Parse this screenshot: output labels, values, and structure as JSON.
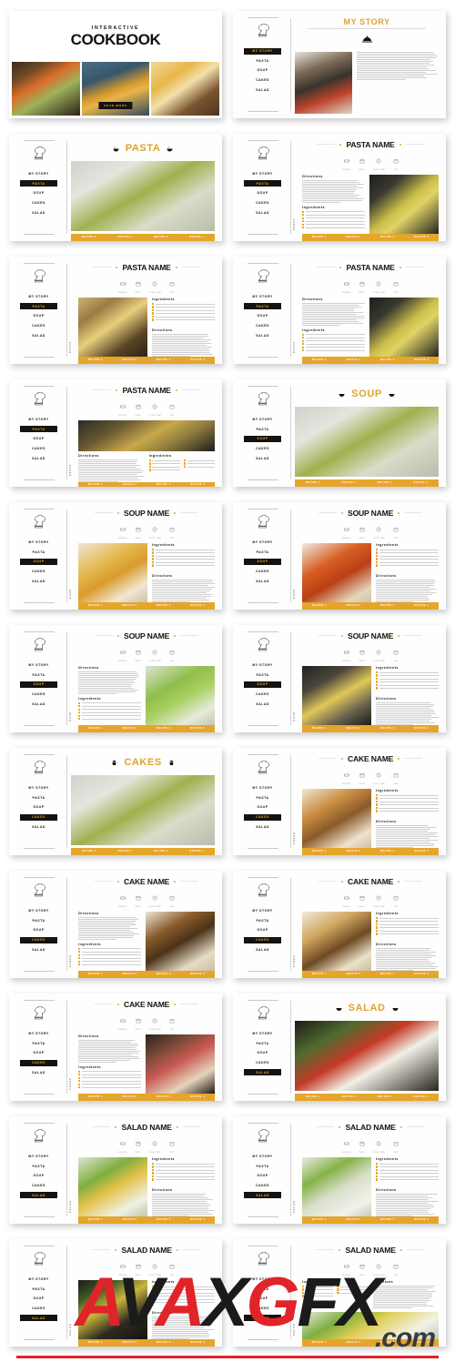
{
  "meta": {
    "accent_yellow": "#E6A52A",
    "accent_title_yellow": "#E2A12C",
    "dark": "#15120F",
    "watermark_red": "#E0242A"
  },
  "nav": {
    "items": [
      "MY STORY",
      "PASTA",
      "SOUP",
      "CAKES",
      "SALAD"
    ],
    "logo_icon": "chef-hat-icon"
  },
  "recipe_bar": {
    "buttons": [
      "RECIPE 1",
      "RECIPE 2",
      "RECIPE 3",
      "RECIPE 4"
    ]
  },
  "meta_icons": [
    {
      "icon": "plate-cutlery-icon",
      "label": "SERVES"
    },
    {
      "icon": "calendar-icon",
      "label": "DATE"
    },
    {
      "icon": "clock-icon",
      "label": "COOK TIME"
    },
    {
      "icon": "oven-icon",
      "label": "FAT"
    }
  ],
  "blocks": {
    "directions": "Directions",
    "ingredients": "Ingredients"
  },
  "cover": {
    "subtitle": "INTERACTIVE",
    "title": "COOKBOOK",
    "button": "READ MORE",
    "images": [
      "salad-photo",
      "pasta-pan-photo",
      "orange-cake-photo"
    ]
  },
  "slides": [
    {
      "id": "cover",
      "type": "cover"
    },
    {
      "id": "my-story",
      "type": "story",
      "title": "MY STORY",
      "active": "MY STORY",
      "icon": "cloche-icon",
      "photo": "p-story"
    },
    {
      "id": "pasta-section",
      "type": "section",
      "title": "PASTA",
      "active": "PASTA",
      "side_icon": "noodle-bowl-icon",
      "photo": "p-pasta"
    },
    {
      "id": "pasta-1",
      "type": "recipe",
      "title": "PASTA NAME",
      "active": "PASTA",
      "layout": "text-left-photo-right",
      "vlabel": "PASTA",
      "photo": "p-pasta2"
    },
    {
      "id": "pasta-2",
      "type": "recipe",
      "title": "PASTA NAME",
      "active": "PASTA",
      "layout": "photo-left-text-right",
      "vlabel": "PASTA",
      "photo": "p-pasta3"
    },
    {
      "id": "pasta-3",
      "type": "recipe",
      "title": "PASTA NAME",
      "active": "PASTA",
      "layout": "text-left-photo-right",
      "vlabel": "PASTA",
      "photo": "p-pasta2"
    },
    {
      "id": "pasta-4",
      "type": "recipe",
      "title": "PASTA NAME",
      "active": "PASTA",
      "layout": "photo-top-text-bottom",
      "vlabel": "PASTA",
      "photo": "p-pasta4"
    },
    {
      "id": "soup-section",
      "type": "section",
      "title": "SOUP",
      "active": "SOUP",
      "side_icon": "soup-bowl-icon",
      "photo": "p-pasta"
    },
    {
      "id": "soup-1",
      "type": "recipe",
      "title": "SOUP NAME",
      "active": "SOUP",
      "layout": "photo-left-text-right",
      "vlabel": "SOUP",
      "photo": "p-soup1"
    },
    {
      "id": "soup-2",
      "type": "recipe",
      "title": "SOUP NAME",
      "active": "SOUP",
      "layout": "photo-left-text-right",
      "vlabel": "SOUP",
      "photo": "p-soup2"
    },
    {
      "id": "soup-3",
      "type": "recipe",
      "title": "SOUP NAME",
      "active": "SOUP",
      "layout": "text-left-photo-right",
      "vlabel": "SOUP",
      "photo": "p-soup3"
    },
    {
      "id": "soup-4",
      "type": "recipe",
      "title": "SOUP NAME",
      "active": "SOUP",
      "layout": "photo-left-text-right",
      "vlabel": "SOUP",
      "photo": "p-soup4"
    },
    {
      "id": "cakes-section",
      "type": "section",
      "title": "CAKES",
      "active": "CAKES",
      "side_icon": "cupcake-icon",
      "photo": "p-pasta"
    },
    {
      "id": "cake-1",
      "type": "recipe",
      "title": "CAKE NAME",
      "active": "CAKES",
      "layout": "photo-left-text-right",
      "vlabel": "CAKES",
      "photo": "p-cake1"
    },
    {
      "id": "cake-2",
      "type": "recipe",
      "title": "CAKE NAME",
      "active": "CAKES",
      "layout": "text-left-photo-right",
      "vlabel": "CAKES",
      "photo": "p-cake2"
    },
    {
      "id": "cake-3",
      "type": "recipe",
      "title": "CAKE NAME",
      "active": "CAKES",
      "layout": "photo-left-text-right",
      "vlabel": "CAKES",
      "photo": "p-cake3"
    },
    {
      "id": "cake-4",
      "type": "recipe",
      "title": "CAKE NAME",
      "active": "CAKES",
      "layout": "text-left-photo-right",
      "vlabel": "CAKES",
      "photo": "p-cake4"
    },
    {
      "id": "salad-section",
      "type": "section",
      "title": "SALAD",
      "active": "SALAD",
      "side_icon": "salad-bowl-icon",
      "photo": "p-salad1"
    },
    {
      "id": "salad-1",
      "type": "recipe",
      "title": "SALAD NAME",
      "active": "SALAD",
      "layout": "photo-left-text-right",
      "vlabel": "SALAD",
      "photo": "p-salad2"
    },
    {
      "id": "salad-2",
      "type": "recipe",
      "title": "SALAD NAME",
      "active": "SALAD",
      "layout": "photo-left-text-right",
      "vlabel": "SALAD",
      "photo": "p-salad3"
    },
    {
      "id": "salad-3",
      "type": "recipe",
      "title": "SALAD NAME",
      "active": "SALAD",
      "layout": "photo-left-text-right",
      "vlabel": "SALAD",
      "photo": "p-salad4"
    },
    {
      "id": "salad-4",
      "type": "recipe",
      "title": "SALAD NAME",
      "active": "SALAD",
      "layout": "text-top-photo-bottom",
      "vlabel": "SALAD",
      "photo": "p-salad5"
    }
  ],
  "watermark": {
    "part_a": "A",
    "part_v": "V",
    "part_x": "A",
    "part_g": "X",
    "part_f": "G",
    "part_x2": "FX",
    "domain": ".com"
  }
}
